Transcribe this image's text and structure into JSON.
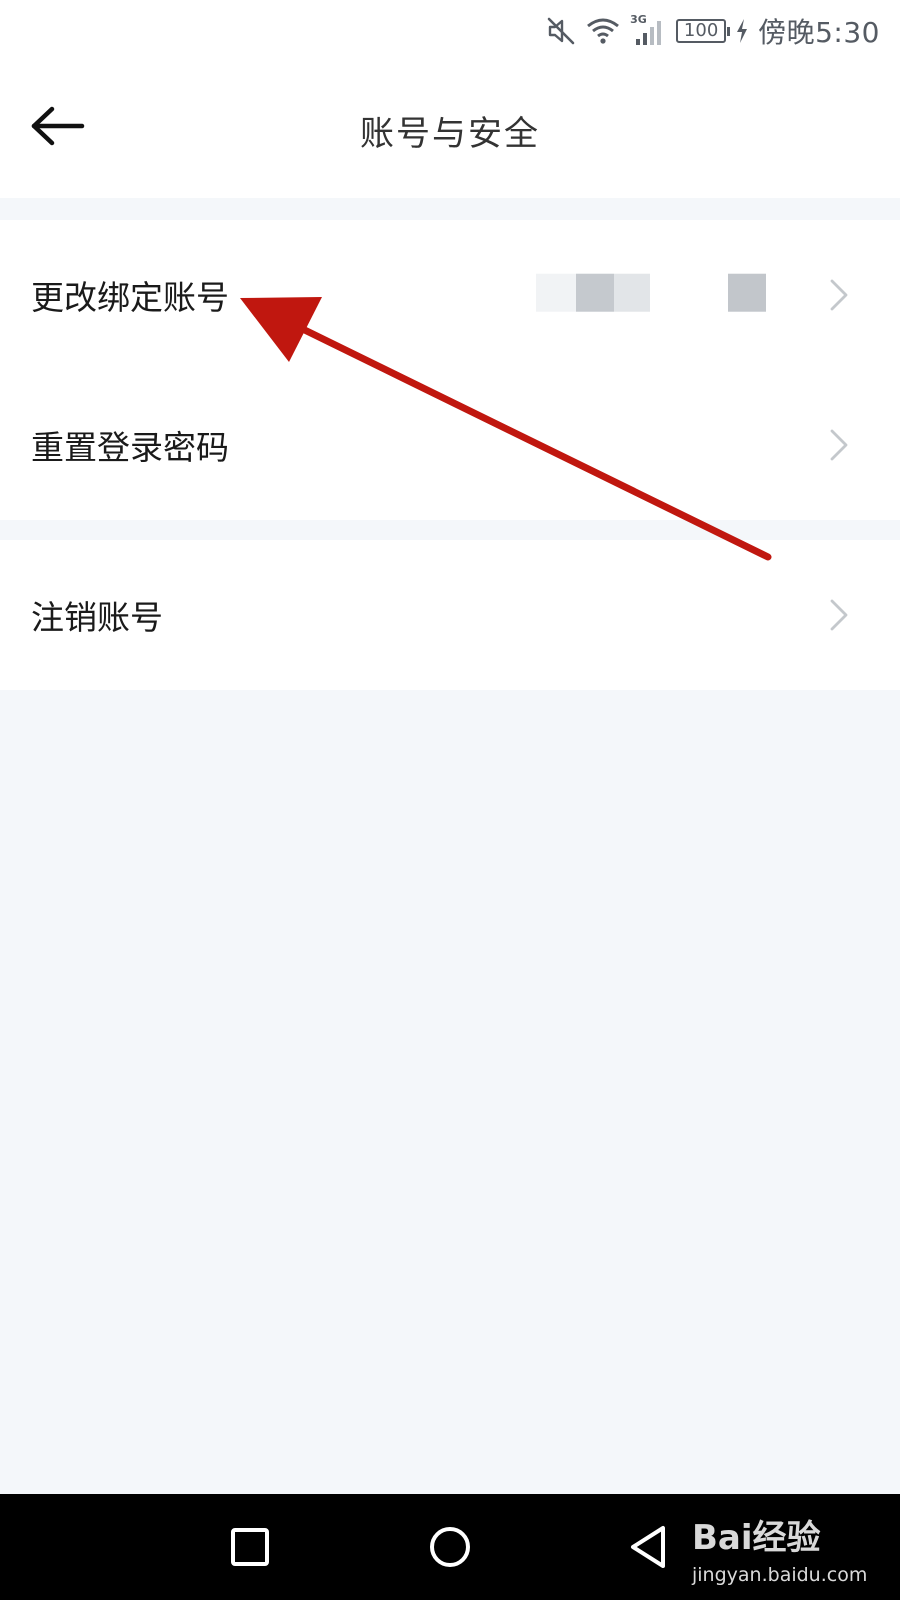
{
  "status_bar": {
    "battery": "100",
    "network": "3G",
    "time": "傍晚5:30"
  },
  "header": {
    "title": "账号与安全",
    "back_icon": "arrow-left-icon"
  },
  "groups": [
    {
      "items": [
        {
          "label": "更改绑定账号",
          "has_masked_value": true,
          "chevron_icon": "chevron-right-icon"
        },
        {
          "label": "重置登录密码",
          "chevron_icon": "chevron-right-icon"
        }
      ]
    },
    {
      "items": [
        {
          "label": "注销账号",
          "chevron_icon": "chevron-right-icon"
        }
      ]
    }
  ],
  "system_nav": {
    "recent_icon": "square-icon",
    "home_icon": "circle-icon",
    "back_icon": "triangle-back-icon"
  },
  "watermark": {
    "line1": "Bai经验",
    "line2": "jingyan.baidu.com"
  },
  "colors": {
    "page_background": "#f4f7fa",
    "annotation_arrow": "#c0170f",
    "chevron": "#c4c8cc"
  }
}
